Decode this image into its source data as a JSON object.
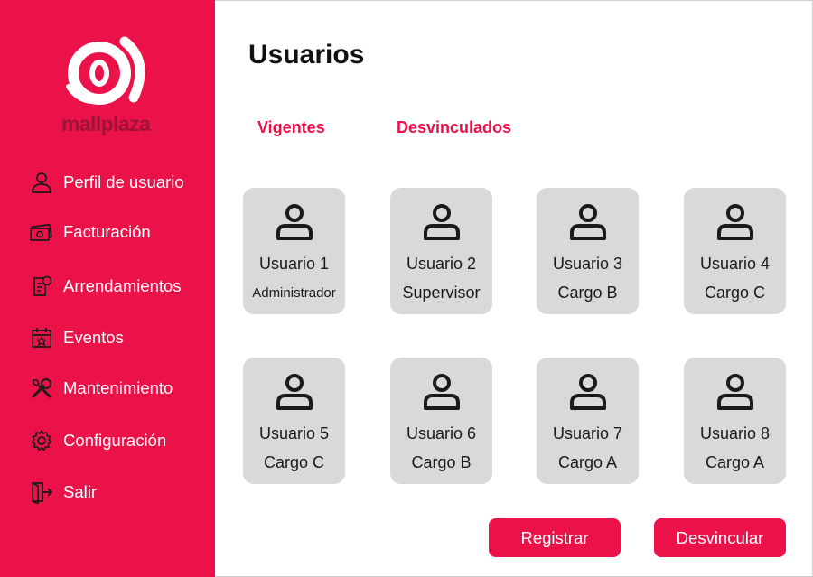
{
  "sidebar": {
    "logo_text": "mallplaza",
    "items": [
      {
        "label": "Perfil de usuario",
        "icon": "user-icon"
      },
      {
        "label": "Facturación",
        "icon": "money-icon"
      },
      {
        "label": "Arrendamientos",
        "icon": "document-dollar-icon"
      },
      {
        "label": "Eventos",
        "icon": "calendar-star-icon"
      },
      {
        "label": "Mantenimiento",
        "icon": "tools-icon"
      },
      {
        "label": "Configuración",
        "icon": "gear-icon"
      },
      {
        "label": "Salir",
        "icon": "logout-icon"
      }
    ]
  },
  "main": {
    "title": "Usuarios",
    "tabs": [
      {
        "label": "Vigentes"
      },
      {
        "label": "Desvinculados"
      }
    ],
    "users": [
      {
        "name": "Usuario 1",
        "role": "Administrador"
      },
      {
        "name": "Usuario 2",
        "role": "Supervisor"
      },
      {
        "name": "Usuario 3",
        "role": "Cargo B"
      },
      {
        "name": "Usuario 4",
        "role": "Cargo C"
      },
      {
        "name": "Usuario 5",
        "role": "Cargo C"
      },
      {
        "name": "Usuario 6",
        "role": "Cargo B"
      },
      {
        "name": "Usuario 7",
        "role": "Cargo A"
      },
      {
        "name": "Usuario 8",
        "role": "Cargo A"
      }
    ],
    "buttons": {
      "register": "Registrar",
      "unlink": "Desvincular"
    }
  },
  "colors": {
    "brand": "#eb124a",
    "card": "#d9d9d9",
    "text": "#111111"
  }
}
